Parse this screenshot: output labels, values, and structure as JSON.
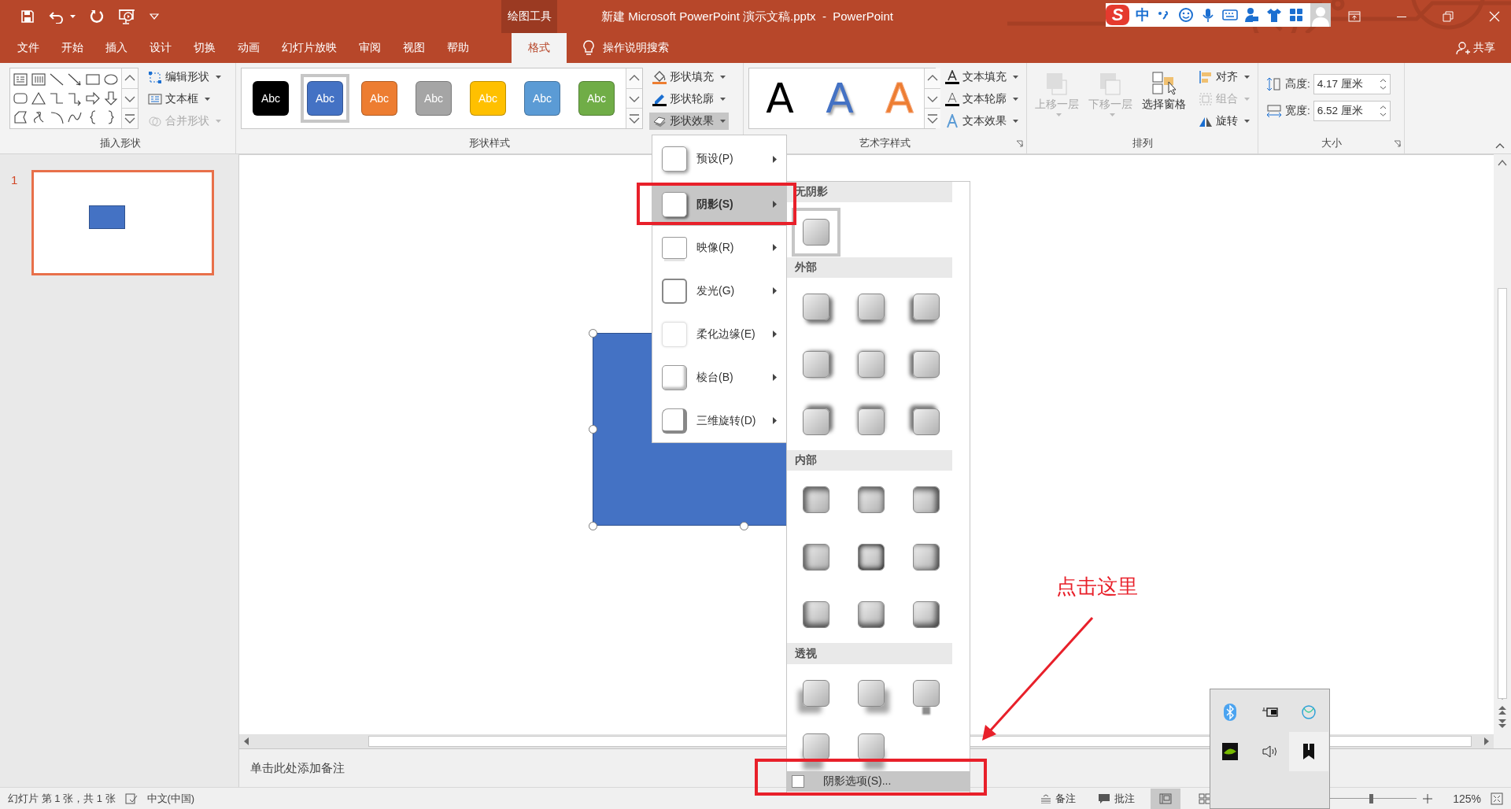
{
  "window": {
    "title": "新建 Microsoft PowerPoint 演示文稿.pptx  -  PowerPoint",
    "context_tab": "绘图工具"
  },
  "ime_toolbar": {
    "logo": "S",
    "mode": "中"
  },
  "tabs": [
    {
      "label": "文件",
      "selected": false
    },
    {
      "label": "开始",
      "selected": false
    },
    {
      "label": "插入",
      "selected": false
    },
    {
      "label": "设计",
      "selected": false
    },
    {
      "label": "切换",
      "selected": false
    },
    {
      "label": "动画",
      "selected": false
    },
    {
      "label": "幻灯片放映",
      "selected": false
    },
    {
      "label": "审阅",
      "selected": false
    },
    {
      "label": "视图",
      "selected": false
    },
    {
      "label": "帮助",
      "selected": false
    },
    {
      "label": "格式",
      "selected": true
    }
  ],
  "tell_me": {
    "label": "操作说明搜索"
  },
  "share": {
    "label": "共享"
  },
  "ribbon": {
    "insert_shapes": {
      "title": "插入形状",
      "commands": [
        {
          "label": "编辑形状",
          "kind": "edit-shape",
          "disabled": false
        },
        {
          "label": "文本框",
          "kind": "text-box",
          "disabled": false
        },
        {
          "label": "合并形状",
          "kind": "merge",
          "disabled": true
        }
      ]
    },
    "shape_styles": {
      "title": "形状样式",
      "styles": [
        {
          "label": "Abc",
          "color": "#000000",
          "selected": false
        },
        {
          "label": "Abc",
          "color": "#4472c4",
          "selected": true
        },
        {
          "label": "Abc",
          "color": "#ed7d31",
          "selected": false
        },
        {
          "label": "Abc",
          "color": "#a5a5a5",
          "selected": false
        },
        {
          "label": "Abc",
          "color": "#ffc000",
          "selected": false
        },
        {
          "label": "Abc",
          "color": "#5b9bd5",
          "selected": false
        },
        {
          "label": "Abc",
          "color": "#70ad47",
          "selected": false
        }
      ],
      "commands": [
        {
          "label": "形状填充",
          "kind": "fill",
          "pressed": false
        },
        {
          "label": "形状轮廓",
          "kind": "outline",
          "pressed": false
        },
        {
          "label": "形状效果",
          "kind": "effects",
          "pressed": true
        }
      ]
    },
    "wordart_styles": {
      "title": "艺术字样式",
      "styles": [
        {
          "label": "A",
          "kind": "solid",
          "color": "#000000"
        },
        {
          "label": "A",
          "kind": "shadow",
          "color": "#4472c4"
        },
        {
          "label": "A",
          "kind": "outline",
          "color": "#ed7d31"
        }
      ],
      "commands": [
        {
          "label": "文本填充",
          "kind": "fill"
        },
        {
          "label": "文本轮廓",
          "kind": "outline"
        },
        {
          "label": "文本效果",
          "kind": "effects"
        }
      ]
    },
    "arrange": {
      "title": "排列",
      "large": [
        {
          "label": "上移一层",
          "kind": "forward",
          "disabled": true,
          "dropdown": true
        },
        {
          "label": "下移一层",
          "kind": "backward",
          "disabled": true,
          "dropdown": true
        },
        {
          "label": "选择窗格",
          "kind": "pane",
          "disabled": false,
          "dropdown": false
        }
      ],
      "small": [
        {
          "label": "对齐",
          "kind": "align",
          "disabled": false
        },
        {
          "label": "组合",
          "kind": "group",
          "disabled": true
        },
        {
          "label": "旋转",
          "kind": "rotate",
          "disabled": false
        }
      ]
    },
    "size": {
      "title": "大小",
      "fields": [
        {
          "label": "高度:",
          "value": "4.17 厘米",
          "kind": "height"
        },
        {
          "label": "宽度:",
          "value": "6.52 厘米",
          "kind": "width"
        }
      ]
    }
  },
  "effects_menu": {
    "items": [
      {
        "label": "预设(P)",
        "kind": "preset",
        "selected": false
      },
      {
        "label": "阴影(S)",
        "kind": "shadow",
        "selected": true
      },
      {
        "label": "映像(R)",
        "kind": "reflection",
        "selected": false
      },
      {
        "label": "发光(G)",
        "kind": "glow",
        "selected": false
      },
      {
        "label": "柔化边缘(E)",
        "kind": "soft-edges",
        "selected": false
      },
      {
        "label": "棱台(B)",
        "kind": "bevel",
        "selected": false
      },
      {
        "label": "三维旋转(D)",
        "kind": "rotation",
        "selected": false
      }
    ]
  },
  "shadow_gallery": {
    "sections": [
      {
        "title": "无阴影",
        "kind": "none",
        "items": [
          {
            "selected": true
          }
        ]
      },
      {
        "title": "外部",
        "kind": "outer",
        "items": [
          {
            "selected": false
          },
          {
            "selected": false
          },
          {
            "selected": false
          },
          {
            "selected": false
          },
          {
            "selected": false
          },
          {
            "selected": false
          },
          {
            "selected": false
          },
          {
            "selected": false
          },
          {
            "selected": false
          }
        ]
      },
      {
        "title": "内部",
        "kind": "inner",
        "items": [
          {
            "selected": false
          },
          {
            "selected": false
          },
          {
            "selected": false
          },
          {
            "selected": false
          },
          {
            "selected": false
          },
          {
            "selected": false
          },
          {
            "selected": false
          },
          {
            "selected": false
          },
          {
            "selected": false
          }
        ]
      },
      {
        "title": "透视",
        "kind": "perspective",
        "items": [
          {
            "selected": false
          },
          {
            "selected": false
          },
          {
            "selected": false
          },
          {
            "selected": false
          },
          {
            "selected": false
          }
        ]
      }
    ],
    "footer": {
      "label": "阴影选项(S)...",
      "highlighted": true
    }
  },
  "slides_pane": {
    "thumbnails": [
      {
        "number": "1",
        "selected": true
      }
    ]
  },
  "notes": {
    "placeholder": "单击此处添加备注"
  },
  "status_bar": {
    "slide_info": "幻灯片 第 1 张，共 1 张",
    "language": "中文(中国)",
    "notes_button": "备注",
    "comments_button": "批注",
    "zoom_slider": {
      "level": 0.72
    },
    "zoom": "125%"
  },
  "annotation": {
    "label": "点击这里"
  }
}
